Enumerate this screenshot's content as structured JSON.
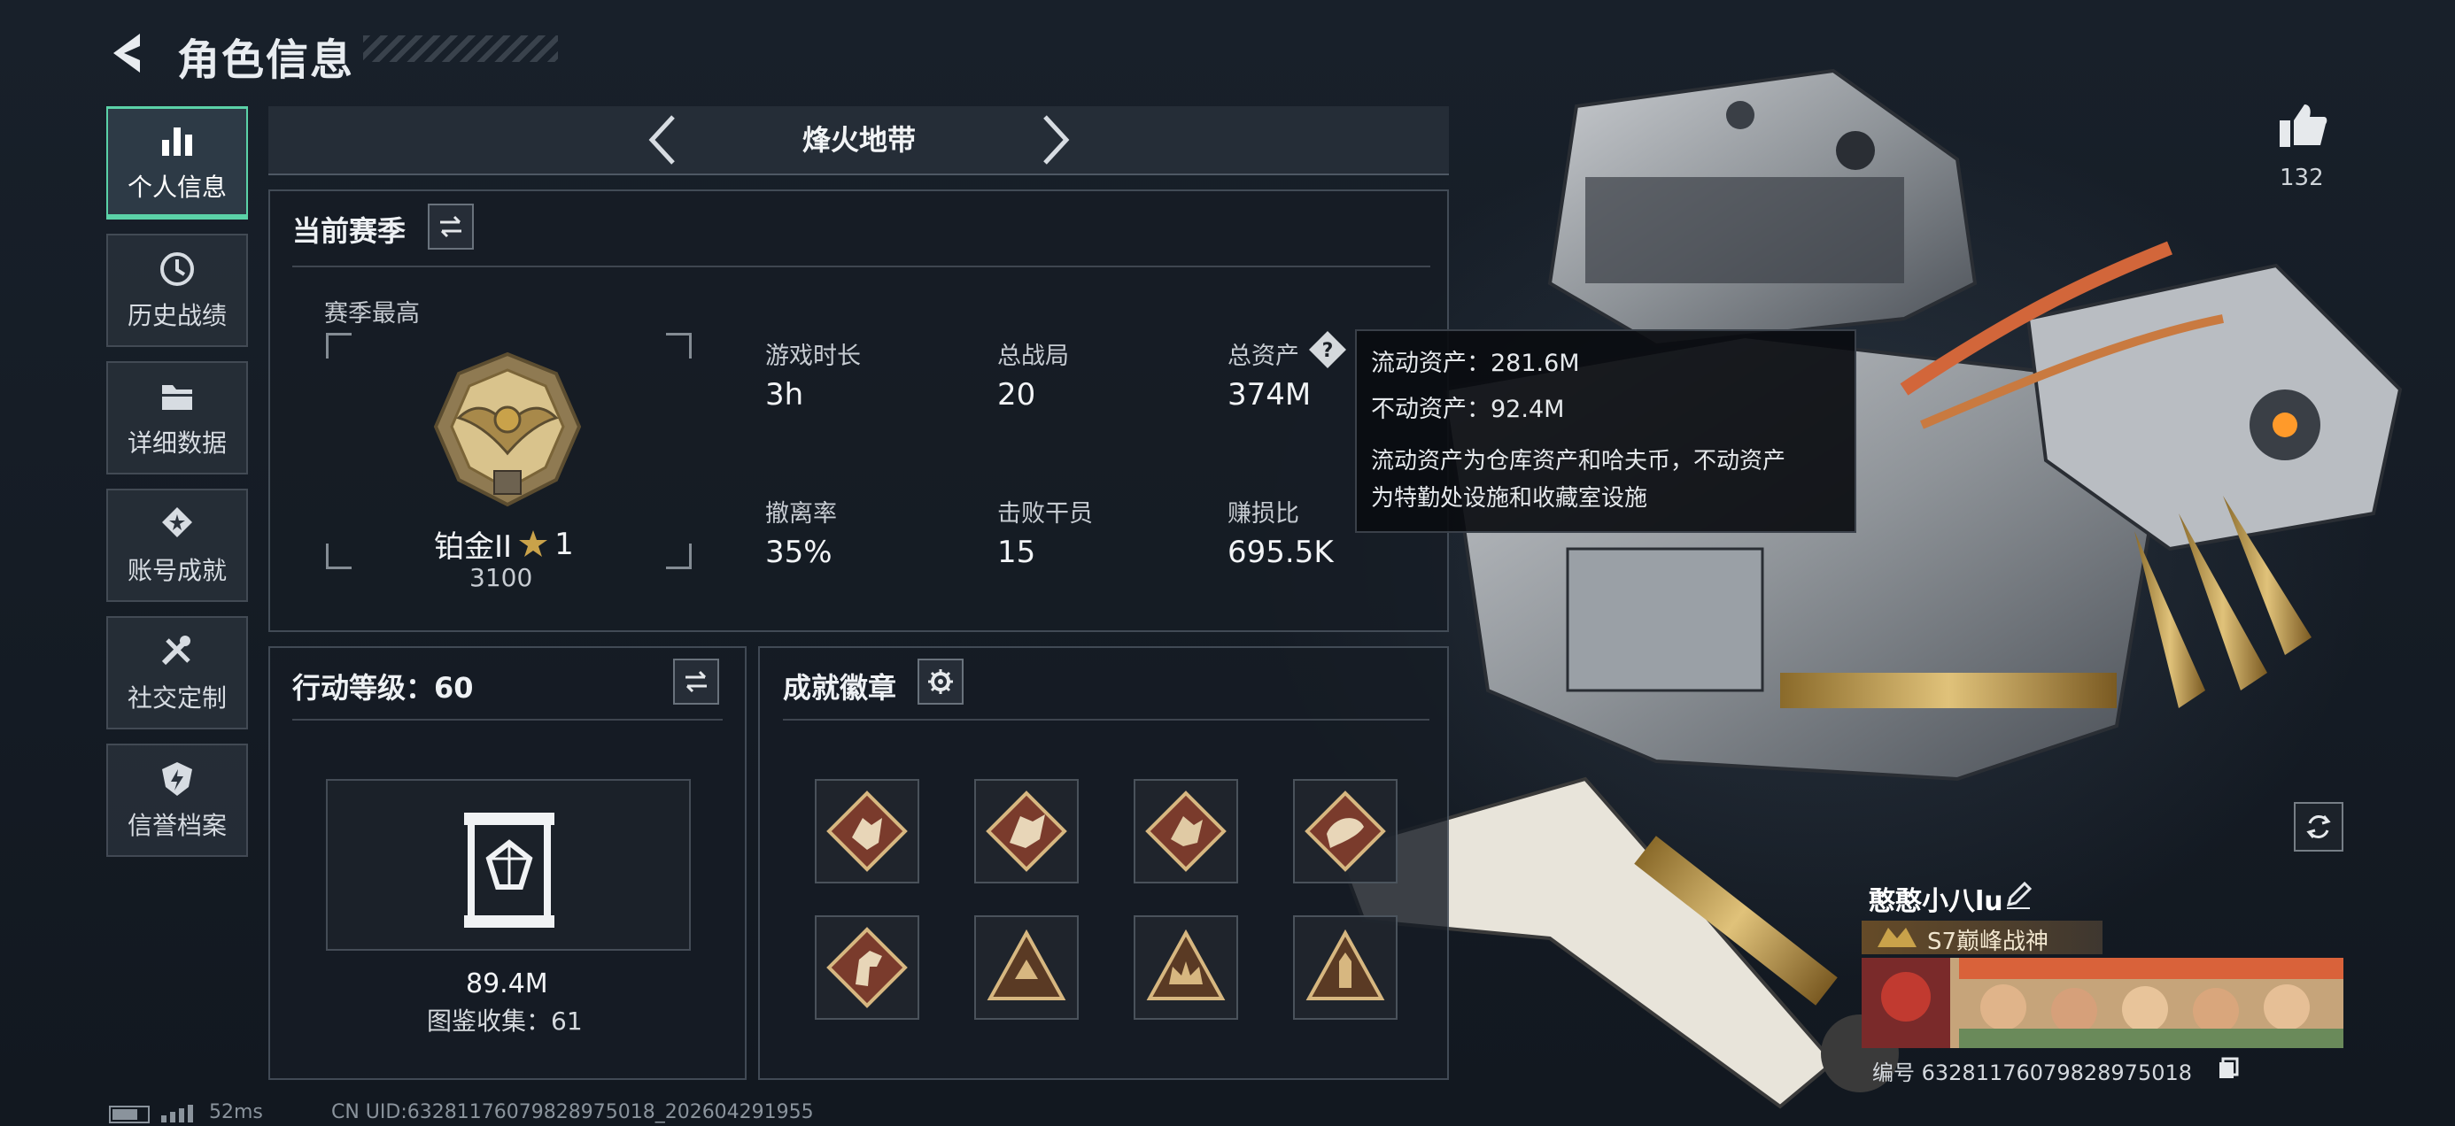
{
  "header": {
    "title": "角色信息"
  },
  "nav": {
    "items": [
      {
        "label": "个人信息",
        "icon": "bar-chart-icon",
        "active": true
      },
      {
        "label": "历史战绩",
        "icon": "history-clock-icon"
      },
      {
        "label": "详细数据",
        "icon": "folder-icon"
      },
      {
        "label": "账号成就",
        "icon": "achievement-medal-icon"
      },
      {
        "label": "社交定制",
        "icon": "wrench-screwdriver-icon"
      },
      {
        "label": "信誉档案",
        "icon": "reputation-shield-icon"
      }
    ]
  },
  "mode": {
    "name": "烽火地带"
  },
  "season": {
    "title": "当前赛季",
    "best_label": "赛季最高",
    "rank_name": "铂金II",
    "rank_stars": "1",
    "rank_points": "3100",
    "stats": [
      {
        "label": "游戏时长",
        "value": "3h"
      },
      {
        "label": "总战局",
        "value": "20"
      },
      {
        "label": "总资产",
        "value": "374M"
      },
      {
        "label": "撤离率",
        "value": "35%"
      },
      {
        "label": "击败干员",
        "value": "15"
      },
      {
        "label": "赚损比",
        "value": "695.5K"
      }
    ]
  },
  "tooltip": {
    "liquid": "流动资产：281.6M",
    "fixed": "不动资产：92.4M",
    "desc_line1": "流动资产为仓库资产和哈夫币，不动资产",
    "desc_line2": "为特勤处设施和收藏室设施"
  },
  "action_level": {
    "title": "行动等级：60",
    "collection_value": "89.4M",
    "collection_count": "图鉴收集：61"
  },
  "badges": {
    "title": "成就徽章",
    "items": [
      "wolf-badge",
      "dragon-badge",
      "dragon-badge-2",
      "serpent-badge",
      "horse-badge",
      "triangle-badge",
      "crown-triangle-badge",
      "tower-triangle-badge"
    ]
  },
  "likes": {
    "count": "132"
  },
  "profile": {
    "name": "憨憨小八lu",
    "title": "S7巅峰战神",
    "id": "编号 632811760798289750​18"
  },
  "status": {
    "ping": "52ms",
    "uid": "CN UID:632811760798289750​18_202604291955"
  },
  "colors": {
    "accent": "#5bd2a8",
    "gold": "#c9a24a",
    "panel": "#161c24"
  }
}
